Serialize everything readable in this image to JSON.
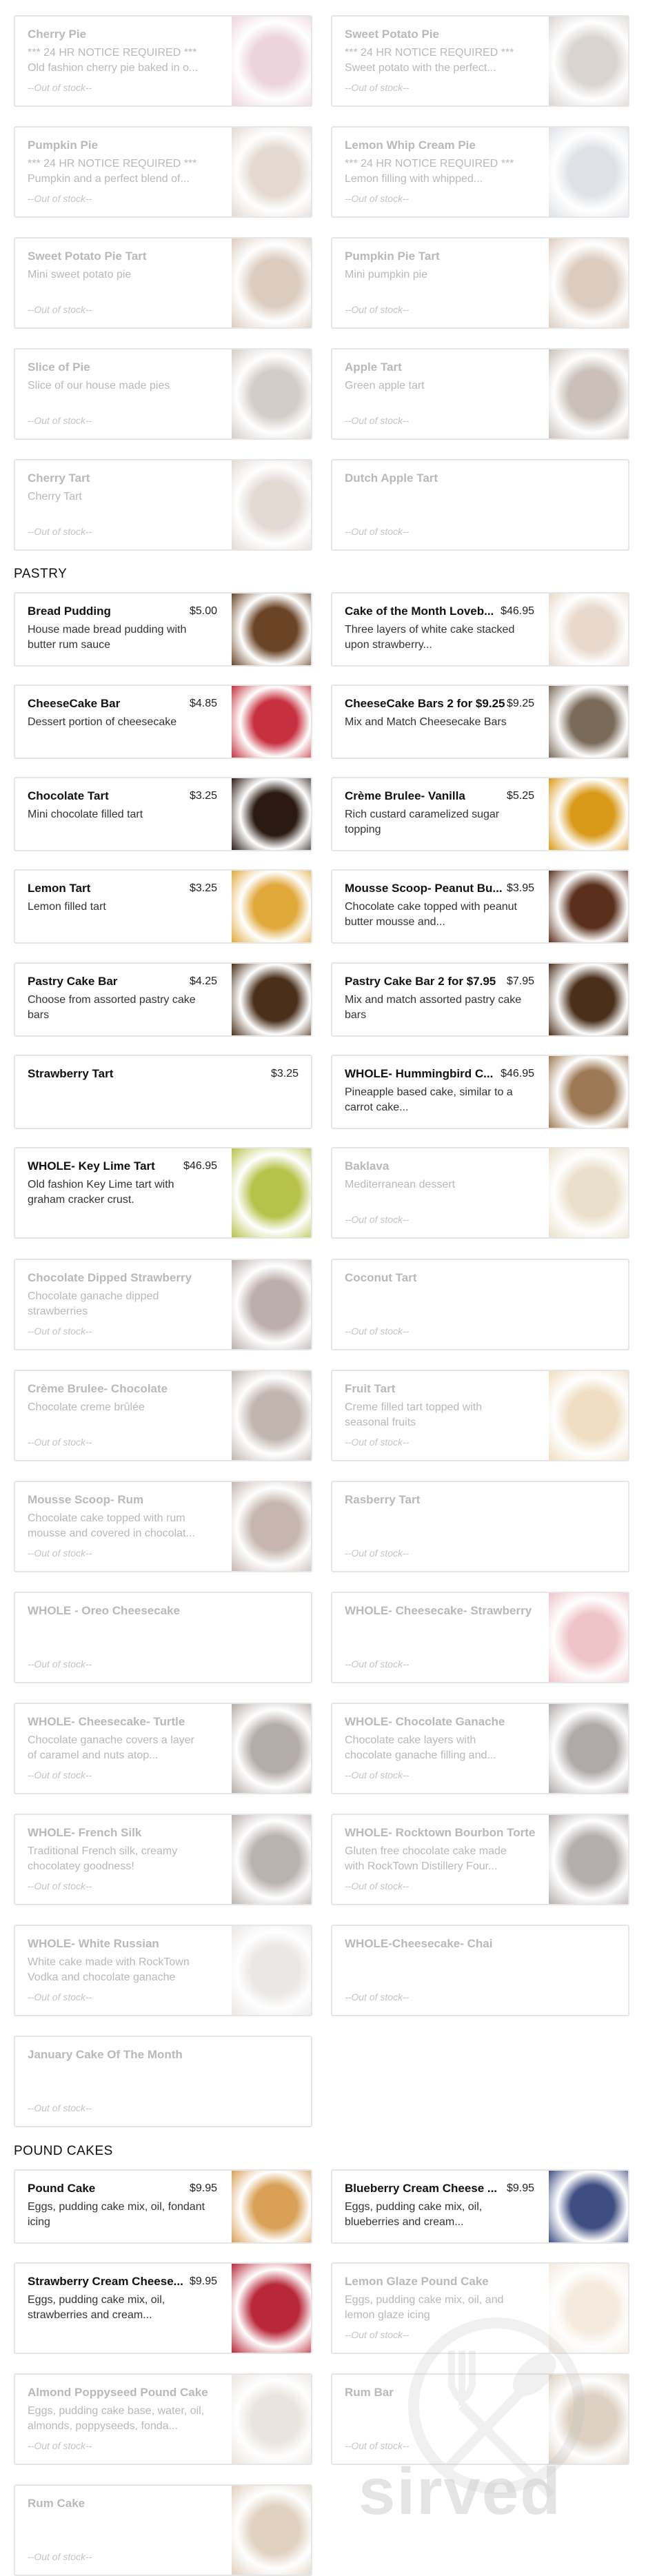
{
  "sections": {
    "pastry": "PASTRY",
    "pound_cakes": "POUND CAKES"
  },
  "items": [
    {
      "name": "Cherry Pie",
      "desc": "*** 24 HR NOTICE REQUIRED *** Old fashion cherry pie baked in o...",
      "price": "",
      "stock": "--Out of stock--",
      "photo": "cherry-pie-photo",
      "color": "#cf8fa4"
    },
    {
      "name": "Sweet Potato Pie",
      "desc": "*** 24 HR NOTICE REQUIRED *** Sweet potato with the perfect...",
      "price": "",
      "stock": "--Out of stock--",
      "photo": "sweet-potato-pie-photo",
      "color": "#9c8f84"
    },
    {
      "name": "Pumpkin Pie",
      "desc": "*** 24 HR NOTICE REQUIRED *** Pumpkin and a perfect blend of...",
      "price": "",
      "stock": "--Out of stock--",
      "photo": "pumpkin-pie-photo",
      "color": "#b69b83"
    },
    {
      "name": "Lemon Whip Cream Pie",
      "desc": "*** 24 HR NOTICE REQUIRED *** Lemon filling with whipped...",
      "price": "",
      "stock": "--Out of stock--",
      "photo": "lemon-whip-pie-photo",
      "color": "#a9b3bf"
    },
    {
      "name": "Sweet Potato Pie Tart",
      "desc": "Mini sweet potato pie",
      "price": "",
      "stock": "--Out of stock--",
      "photo": "sweet-potato-tart-photo",
      "color": "#a47a59"
    },
    {
      "name": "Pumpkin Pie Tart",
      "desc": "Mini pumpkin pie",
      "price": "",
      "stock": "--Out of stock--",
      "photo": "pumpkin-tart-photo",
      "color": "#a47a59"
    },
    {
      "name": "Slice of Pie",
      "desc": "Slice of our house made pies",
      "price": "",
      "stock": "--Out of stock--",
      "photo": "pie-slice-photo",
      "color": "#8f7a6b"
    },
    {
      "name": "Apple Tart",
      "desc": "Green apple tart",
      "price": "",
      "stock": "--Out of stock--",
      "photo": "apple-tart-photo",
      "color": "#735a47"
    },
    {
      "name": "Cherry Tart",
      "desc": "Cherry Tart",
      "price": "",
      "stock": "--Out of stock--",
      "photo": "cherry-tart-photo",
      "color": "#b79d8e"
    },
    {
      "name": "Dutch Apple Tart",
      "desc": "",
      "price": "",
      "stock": "--Out of stock--",
      "photo": "",
      "color": ""
    },
    {
      "name": "Bread Pudding",
      "desc": "House made bread pudding with butter rum sauce",
      "price": "$5.00",
      "stock": "",
      "photo": "bread-pudding-photo",
      "color": "#6b4426"
    },
    {
      "name": "Cake of the Month Loveb...",
      "desc": "Three layers of white cake stacked upon strawberry...",
      "price": "$46.95",
      "stock": "",
      "photo": "cake-of-month-photo",
      "color": "#e8d9cc"
    },
    {
      "name": "CheeseCake Bar",
      "desc": "Dessert portion of cheesecake",
      "price": "$4.85",
      "stock": "",
      "photo": "cheesecake-bar-photo",
      "color": "#c7303e"
    },
    {
      "name": "CheeseCake Bars 2 for $9.25",
      "desc": "Mix and Match Cheesecake Bars",
      "price": "$9.25",
      "stock": "",
      "photo": "cheesecake-bars-photo",
      "color": "#7a6a59"
    },
    {
      "name": "Chocolate Tart",
      "desc": "Mini chocolate filled tart",
      "price": "$3.25",
      "stock": "",
      "photo": "chocolate-tart-photo",
      "color": "#2a1a12"
    },
    {
      "name": "Crème Brulee- Vanilla",
      "desc": "Rich custard caramelized sugar topping",
      "price": "$5.25",
      "stock": "",
      "photo": "creme-brulee-vanilla-photo",
      "color": "#d99a1a"
    },
    {
      "name": "Lemon Tart",
      "desc": "Lemon filled tart",
      "price": "$3.25",
      "stock": "",
      "photo": "lemon-tart-photo",
      "color": "#e0a93a"
    },
    {
      "name": "Mousse Scoop- Peanut Bu...",
      "desc": "Chocolate cake topped with peanut butter mousse and...",
      "price": "$3.95",
      "stock": "",
      "photo": "mousse-peanut-photo",
      "color": "#5a2f1c"
    },
    {
      "name": "Pastry Cake Bar",
      "desc": "Choose from assorted pastry cake bars",
      "price": "$4.25",
      "stock": "",
      "photo": "pastry-cake-bar-photo",
      "color": "#4a2f1b"
    },
    {
      "name": "Pastry Cake Bar 2 for $7.95",
      "desc": "Mix and match assorted pastry cake bars",
      "price": "$7.95",
      "stock": "",
      "photo": "pastry-cake-bars-photo",
      "color": "#4a2f1b"
    },
    {
      "name": "Strawberry Tart",
      "desc": "",
      "price": "$3.25",
      "stock": "",
      "photo": "",
      "color": ""
    },
    {
      "name": "WHOLE- Hummingbird C...",
      "desc": "Pineapple based cake, similar to a carrot cake...",
      "price": "$46.95",
      "stock": "",
      "photo": "hummingbird-cake-photo",
      "color": "#9d7a55"
    },
    {
      "name": "WHOLE- Key Lime Tart",
      "desc": "Old fashion Key Lime tart with graham cracker crust.",
      "price": "$46.95",
      "stock": "",
      "photo": "key-lime-tart-photo",
      "color": "#b7c24a"
    },
    {
      "name": "Baklava",
      "desc": "Mediterranean dessert",
      "price": "",
      "stock": "--Out of stock--",
      "photo": "baklava-photo",
      "color": "#c9ab73"
    },
    {
      "name": "Chocolate Dipped Strawberry",
      "desc": "Chocolate ganache dipped strawberries",
      "price": "",
      "stock": "--Out of stock--",
      "photo": "dipped-strawberry-photo",
      "color": "#4e2a20"
    },
    {
      "name": "Coconut Tart",
      "desc": "",
      "price": "",
      "stock": "--Out of stock--",
      "photo": "",
      "color": ""
    },
    {
      "name": "Crème Brulee- Chocolate",
      "desc": "Chocolate creme brûlée",
      "price": "",
      "stock": "--Out of stock--",
      "photo": "creme-brulee-chocolate-photo",
      "color": "#5b3d2d"
    },
    {
      "name": "Fruit Tart",
      "desc": "Creme filled tart topped with seasonal fruits",
      "price": "",
      "stock": "--Out of stock--",
      "photo": "fruit-tart-photo",
      "color": "#d7a65f"
    },
    {
      "name": "Mousse Scoop- Rum",
      "desc": "Chocolate cake topped with rum mousse and covered in chocolat...",
      "price": "",
      "stock": "--Out of stock--",
      "photo": "mousse-rum-photo",
      "color": "#6a3f2c"
    },
    {
      "name": "Rasberry Tart",
      "desc": "",
      "price": "",
      "stock": "--Out of stock--",
      "photo": "",
      "color": ""
    },
    {
      "name": "WHOLE - Oreo Cheesecake",
      "desc": "",
      "price": "",
      "stock": "--Out of stock--",
      "photo": "",
      "color": ""
    },
    {
      "name": "WHOLE- Cheesecake- Strawberry",
      "desc": "",
      "price": "",
      "stock": "--Out of stock--",
      "photo": "strawberry-cheesecake-photo",
      "color": "#d5636f"
    },
    {
      "name": "WHOLE- Cheesecake- Turtle",
      "desc": "Chocolate ganache covers a layer of caramel and nuts atop...",
      "price": "",
      "stock": "--Out of stock--",
      "photo": "turtle-cheesecake-photo",
      "color": "#3b2418"
    },
    {
      "name": "WHOLE- Chocolate Ganache",
      "desc": "Chocolate cake layers with chocolate ganache filling and...",
      "price": "",
      "stock": "--Out of stock--",
      "photo": "chocolate-ganache-photo",
      "color": "#2d1f1a"
    },
    {
      "name": "WHOLE- French Silk",
      "desc": "Traditional French silk, creamy chocolatey goodness!",
      "price": "",
      "stock": "--Out of stock--",
      "photo": "french-silk-photo",
      "color": "#4a352c"
    },
    {
      "name": "WHOLE- Rocktown Bourbon Torte",
      "desc": "Gluten free chocolate cake made with RockTown Distillery Four...",
      "price": "",
      "stock": "--Out of stock--",
      "photo": "bourbon-torte-photo",
      "color": "#3a2a24"
    },
    {
      "name": "WHOLE- White Russian",
      "desc": "White cake made with RockTown Vodka and chocolate ganache",
      "price": "",
      "stock": "--Out of stock--",
      "photo": "white-russian-photo",
      "color": "#c8c0b8"
    },
    {
      "name": "WHOLE-Cheesecake- Chai",
      "desc": "",
      "price": "",
      "stock": "--Out of stock--",
      "photo": "",
      "color": ""
    },
    {
      "name": "January Cake Of The Month",
      "desc": "",
      "price": "",
      "stock": "--Out of stock--",
      "photo": "",
      "color": ""
    },
    {
      "name": "Pound Cake",
      "desc": "Eggs, pudding cake mix, oil, fondant icing",
      "price": "$9.95",
      "stock": "",
      "photo": "pound-cake-photo",
      "color": "#d9a056"
    },
    {
      "name": "Blueberry Cream Cheese ...",
      "desc": "Eggs, pudding cake mix, oil, blueberries and cream...",
      "price": "$9.95",
      "stock": "",
      "photo": "blueberry-pound-photo",
      "color": "#3f4e82"
    },
    {
      "name": "Strawberry Cream Cheese...",
      "desc": "Eggs, pudding cake mix, oil, strawberries and cream...",
      "price": "$9.95",
      "stock": "",
      "photo": "strawberry-pound-photo",
      "color": "#b8283a"
    },
    {
      "name": "Lemon Glaze Pound Cake",
      "desc": "Eggs, pudding cake mix, oil, and lemon glaze icing",
      "price": "",
      "stock": "--Out of stock--",
      "photo": "lemon-glaze-pound-photo",
      "color": "#e3c9a7"
    },
    {
      "name": "Almond Poppyseed Pound Cake",
      "desc": "Eggs, pudding cake base, water, oil, almonds, poppyseeds, fonda...",
      "price": "",
      "stock": "--Out of stock--",
      "photo": "almond-poppyseed-photo",
      "color": "#c8b9a8"
    },
    {
      "name": "Rum Bar",
      "desc": "",
      "price": "",
      "stock": "--Out of stock--",
      "photo": "rum-bar-photo",
      "color": "#a68560"
    },
    {
      "name": "Rum Cake",
      "desc": "",
      "price": "",
      "stock": "--Out of stock--",
      "photo": "rum-cake-photo",
      "color": "#b0865a"
    }
  ],
  "watermark": "sirved"
}
